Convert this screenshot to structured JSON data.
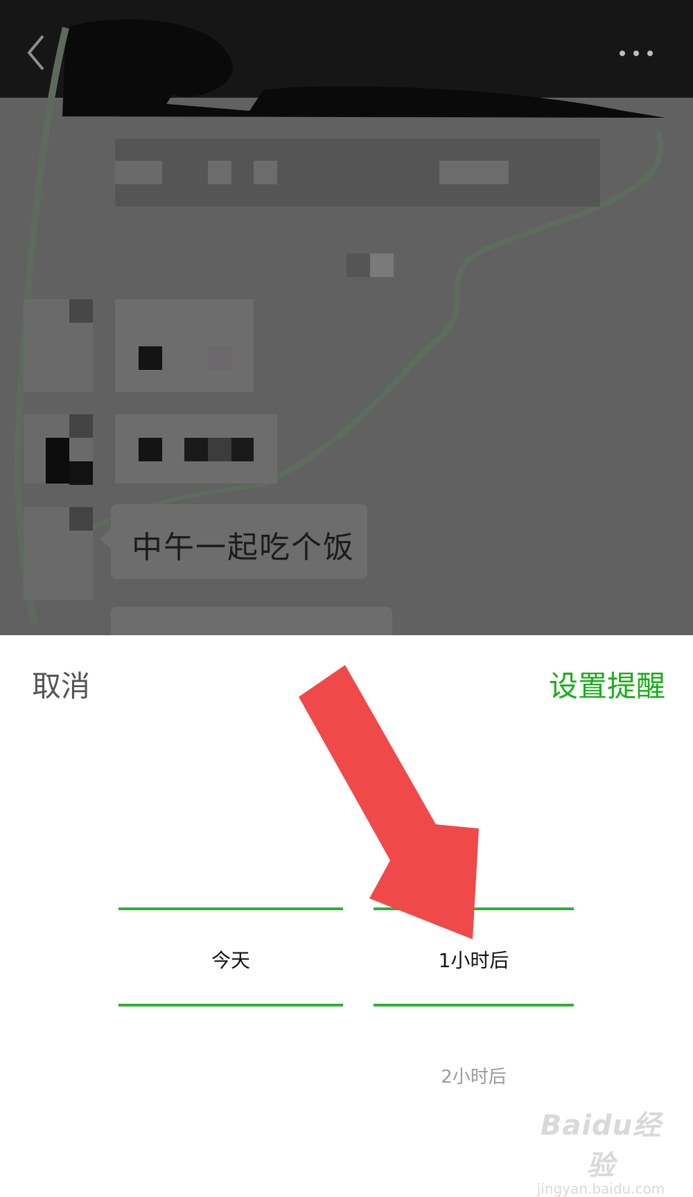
{
  "chat": {
    "message_text": "中午一起吃个饭"
  },
  "reminder_sheet": {
    "cancel_label": "取消",
    "confirm_label": "设置提醒",
    "day_picker": {
      "selected": "今天"
    },
    "time_picker": {
      "selected": "1小时后",
      "next": "2小时后"
    }
  },
  "watermark": {
    "brand": "Baidu经验",
    "domain": "jingyan.baidu.com"
  },
  "colors": {
    "accent_green": "#1aad19",
    "picker_line": "#2eb135",
    "arrow_red": "#f0494a",
    "dim_overlay": "#616161",
    "nav_bar": "#161616"
  },
  "icons": [
    "back-arrow-icon",
    "more-dots-icon"
  ]
}
